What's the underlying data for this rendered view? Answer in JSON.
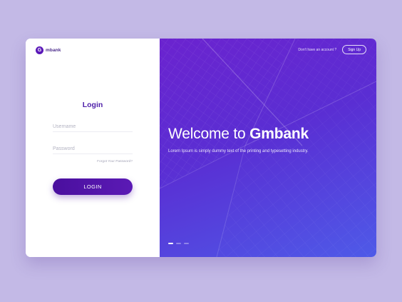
{
  "brand": {
    "logo_letter": "G",
    "logo_text": "mbank"
  },
  "login": {
    "title": "Login",
    "username_placeholder": "Username",
    "password_placeholder": "Password",
    "forgot_label": "Forgot Your Password?",
    "button_label": "LOGIN"
  },
  "hero": {
    "no_account_text": "Don't have an account ?",
    "signup_label": "Sign Up",
    "welcome_prefix": "Welcome to ",
    "welcome_brand": "Gmbank",
    "tagline": "Lorem Ipsum is simply dummy text of the printing and typesetting industry.",
    "slides_total": 3,
    "active_slide": 1
  },
  "colors": {
    "page_background": "#c3b9e6",
    "accent": "#5a18b8",
    "gradient_start": "#6b23cf",
    "gradient_end": "#4e5ae8"
  }
}
